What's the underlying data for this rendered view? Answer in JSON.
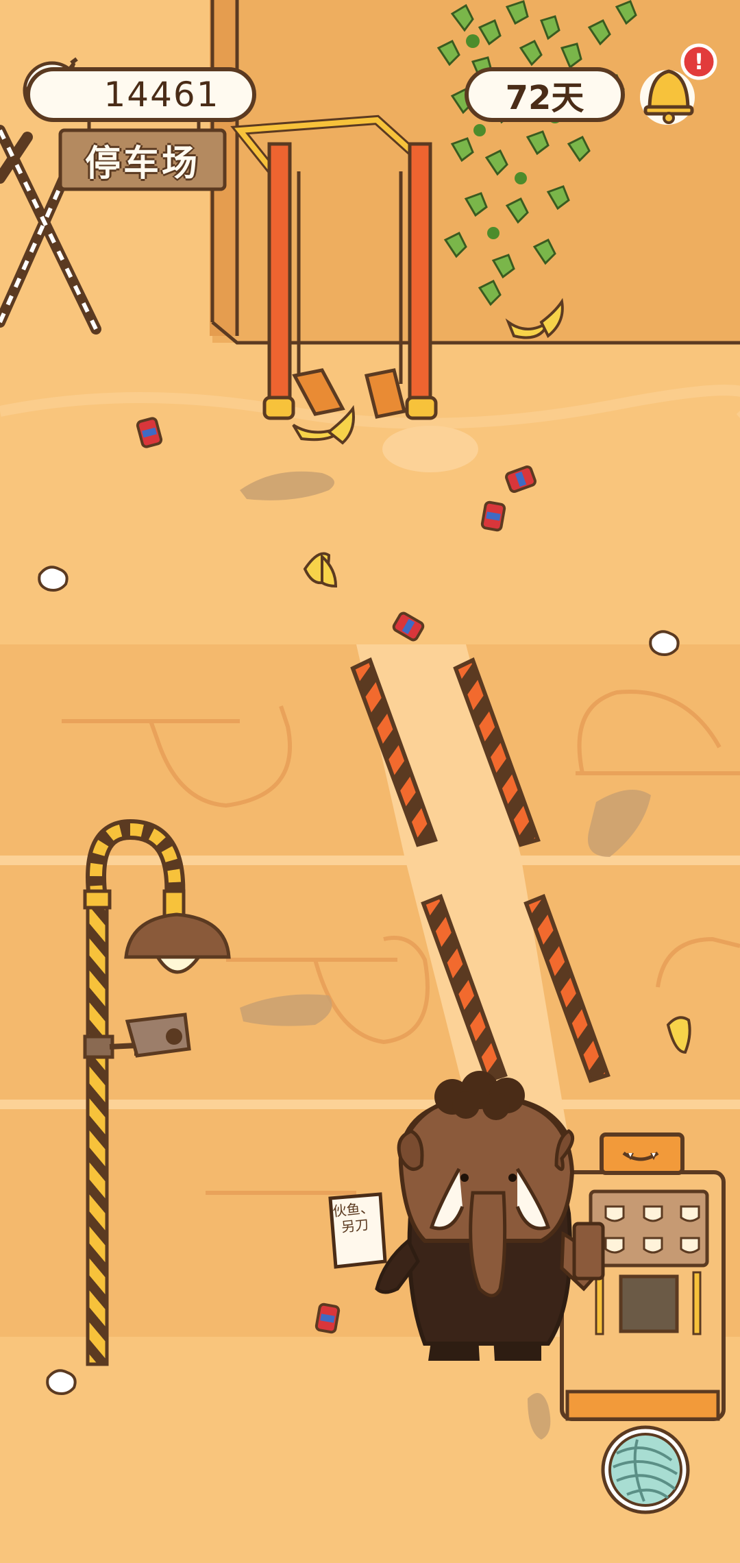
{
  "hud": {
    "coins": "14461",
    "days": "72天",
    "bell_alert": "!"
  },
  "location": {
    "sign": "停车场"
  },
  "props": {
    "paper_text": "伙鱼、另刀"
  },
  "icons": {
    "banana": "banana-icon",
    "bell": "bell-icon",
    "yarn": "yarn-ball-icon"
  },
  "colors": {
    "ground": "#f9c57c",
    "wall": "#eeae5f",
    "outline": "#5b3a21",
    "hazard_orange": "#f26a2e",
    "alert_red": "#e23b3b",
    "yarn": "#a8ddd2"
  }
}
